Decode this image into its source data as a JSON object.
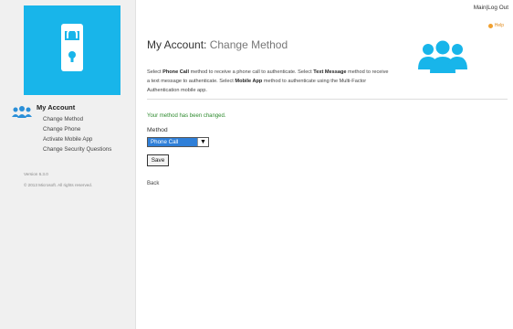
{
  "sidebar": {
    "section_title": "My Account",
    "items": [
      {
        "label": "Change Method"
      },
      {
        "label": "Change Phone"
      },
      {
        "label": "Activate Mobile App"
      },
      {
        "label": "Change Security Questions"
      }
    ],
    "version": "Version 6.3.0",
    "copyright": "© 2013 Microsoft. All rights reserved."
  },
  "header": {
    "main_link": "Main",
    "separator": "|",
    "logout_link": "Log Out",
    "help_label": "Help"
  },
  "main": {
    "title": "My Account:",
    "subtitle": "Change Method",
    "description": {
      "t1": "Select ",
      "b1": "Phone Call",
      "t2": " method to receive a phone call to authenticate. Select ",
      "b2": "Text Message",
      "t3": " method to receive a text message to authenticate. Select ",
      "b3": "Mobile App",
      "t4": " method to authenticate using the Multi-Factor Authentication mobile app."
    },
    "success_message": "Your method has been changed.",
    "method_label": "Method",
    "method_selected": "Phone Call",
    "save_label": "Save",
    "back_label": "Back"
  },
  "colors": {
    "brand_blue": "#18b5ea",
    "success_green": "#2e8b2e",
    "select_blue": "#2f7fd8",
    "help_orange": "#e08a1a"
  },
  "icons": [
    "phone-lock-icon",
    "users-icon",
    "help-icon",
    "chevron-down-icon"
  ]
}
